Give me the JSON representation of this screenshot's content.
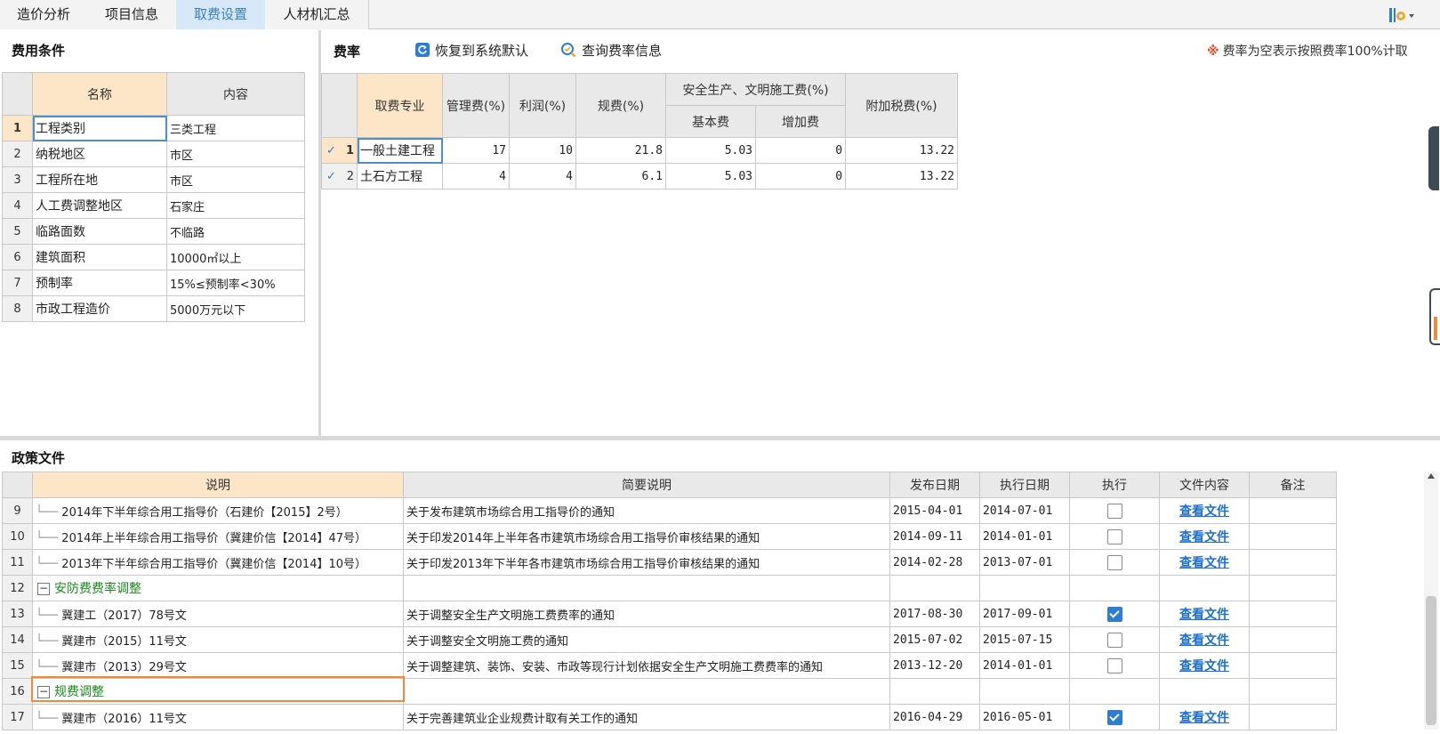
{
  "tabs": [
    {
      "label": "造价分析",
      "active": false
    },
    {
      "label": "项目信息",
      "active": false
    },
    {
      "label": "取费设置",
      "active": true
    },
    {
      "label": "人材机汇总",
      "active": false
    }
  ],
  "fee_conditions": {
    "title": "费用条件",
    "headers": {
      "name": "名称",
      "content": "内容"
    },
    "rows": [
      {
        "n": "1",
        "name": "工程类别",
        "content": "三类工程"
      },
      {
        "n": "2",
        "name": "纳税地区",
        "content": "市区"
      },
      {
        "n": "3",
        "name": "工程所在地",
        "content": "市区"
      },
      {
        "n": "4",
        "name": "人工费调整地区",
        "content": "石家庄"
      },
      {
        "n": "5",
        "name": "临路面数",
        "content": "不临路"
      },
      {
        "n": "6",
        "name": "建筑面积",
        "content": "10000㎡以上"
      },
      {
        "n": "7",
        "name": "预制率",
        "content": "15%≤预制率<30%"
      },
      {
        "n": "8",
        "name": "市政工程造价",
        "content": "5000万元以下"
      }
    ]
  },
  "fee_rates": {
    "title": "费率",
    "restore_button": "恢复到系统默认",
    "query_button": "查询费率信息",
    "note_symbol": "※",
    "note": "费率为空表示按照费率100%计取",
    "headers": {
      "specialty": "取费专业",
      "mgmt": "管理费(%)",
      "profit": "利润(%)",
      "regulatory": "规费(%)",
      "safety_group": "安全生产、文明施工费(%)",
      "basic": "基本费",
      "extra": "增加费",
      "surtax": "附加税费(%)"
    },
    "rows": [
      {
        "n": "1",
        "specialty": "一般土建工程",
        "mgmt": "17",
        "profit": "10",
        "regulatory": "21.8",
        "basic": "5.03",
        "extra": "0",
        "surtax": "13.22"
      },
      {
        "n": "2",
        "specialty": "土石方工程",
        "mgmt": "4",
        "profit": "4",
        "regulatory": "6.1",
        "basic": "5.03",
        "extra": "0",
        "surtax": "13.22"
      }
    ]
  },
  "policy_files": {
    "title": "政策文件",
    "headers": {
      "desc": "说明",
      "summary": "简要说明",
      "pub": "发布日期",
      "exec_date": "执行日期",
      "execute": "执行",
      "file": "文件内容",
      "note": "备注"
    },
    "rows": [
      {
        "n": "9",
        "desc": "2014年下半年综合用工指导价（石建价【2015】2号）",
        "summary": "关于发布建筑市场综合用工指导价的通知",
        "pub": "2015-04-01",
        "exec_date": "2014-07-01",
        "checked": false,
        "file": "查看文件",
        "group": false
      },
      {
        "n": "10",
        "desc": "2014年上半年综合用工指导价（冀建价信【2014】47号）",
        "summary": "关于印发2014年上半年各市建筑市场综合用工指导价审核结果的通知",
        "pub": "2014-09-11",
        "exec_date": "2014-01-01",
        "checked": false,
        "file": "查看文件",
        "group": false
      },
      {
        "n": "11",
        "desc": "2013年下半年综合用工指导价（冀建价信【2014】10号）",
        "summary": "关于印发2013年下半年各市建筑市场综合用工指导价审核结果的通知",
        "pub": "2014-02-28",
        "exec_date": "2013-07-01",
        "checked": false,
        "file": "查看文件",
        "group": false
      },
      {
        "n": "12",
        "desc": "安防费费率调整",
        "summary": "",
        "pub": "",
        "exec_date": "",
        "checked": null,
        "file": "",
        "group": true
      },
      {
        "n": "13",
        "desc": "冀建工（2017）78号文",
        "summary": "关于调整安全生产文明施工费费率的通知",
        "pub": "2017-08-30",
        "exec_date": "2017-09-01",
        "checked": true,
        "file": "查看文件",
        "group": false
      },
      {
        "n": "14",
        "desc": "冀建市（2015）11号文",
        "summary": "关于调整安全文明施工费的通知",
        "pub": "2015-07-02",
        "exec_date": "2015-07-15",
        "checked": false,
        "file": "查看文件",
        "group": false
      },
      {
        "n": "15",
        "desc": "冀建市（2013）29号文",
        "summary": "关于调整建筑、装饰、安装、市政等现行计划依据安全生产文明施工费费率的通知",
        "pub": "2013-12-20",
        "exec_date": "2014-01-01",
        "checked": false,
        "file": "查看文件",
        "group": false
      },
      {
        "n": "16",
        "desc": "规费调整",
        "summary": "",
        "pub": "",
        "exec_date": "",
        "checked": null,
        "file": "",
        "group": true
      },
      {
        "n": "17",
        "desc": "冀建市（2016）11号文",
        "summary": "关于完善建筑业企业规费计取有关工作的通知",
        "pub": "2016-04-29",
        "exec_date": "2016-05-01",
        "checked": true,
        "file": "查看文件",
        "group": false
      }
    ]
  },
  "colors": {
    "tab_active_bg": "#d7e9f8",
    "highlight_header": "#fde6c7",
    "link": "#1b6fd1",
    "group_text": "#1a8a1a",
    "selection_box": "#ef8a3a"
  }
}
